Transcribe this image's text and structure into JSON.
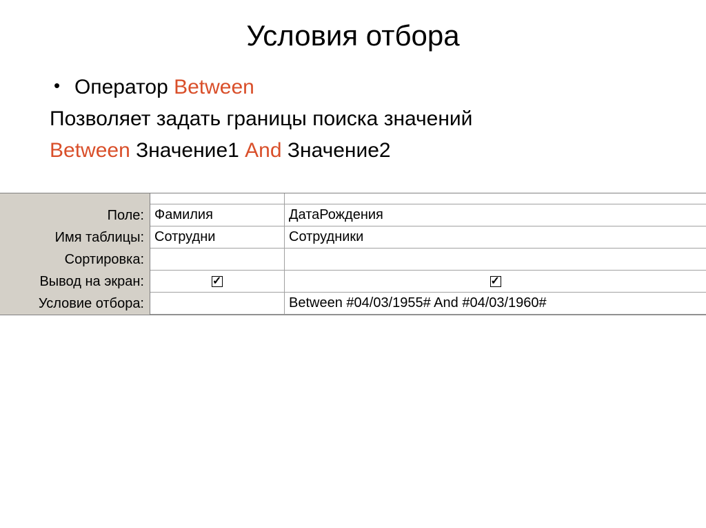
{
  "title": "Условия отбора",
  "bullet": {
    "prefix": "Оператор ",
    "operator": "Between"
  },
  "line1": "Позволяет задать границы поиска значений",
  "line2": {
    "part1": "Between",
    "part2": " Значение1 ",
    "part3": "And",
    "part4": " Значение2"
  },
  "grid": {
    "labels": {
      "field": "Поле:",
      "table": "Имя таблицы:",
      "sort": "Сортировка:",
      "show": "Вывод на экран:",
      "criteria": "Условие отбора:"
    },
    "col1": {
      "field": "Фамилия",
      "table": "Сотрудни",
      "sort": "",
      "criteria": ""
    },
    "col2": {
      "field": "ДатаРождения",
      "table": "Сотрудники",
      "sort": "",
      "criteria": "Between #04/03/1955# And #04/03/1960#"
    }
  }
}
